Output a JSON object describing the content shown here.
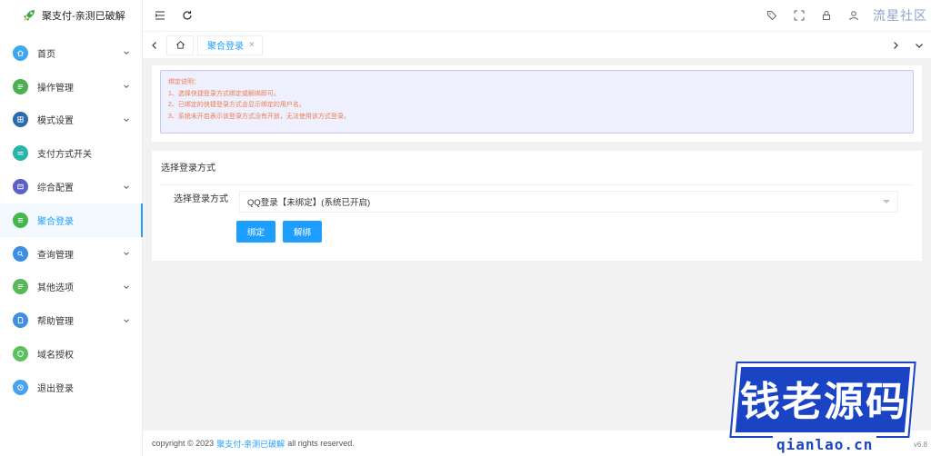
{
  "brand": {
    "title": "聚支付-亲测已破解"
  },
  "header": {
    "watermark": "流星社区"
  },
  "sidebar": {
    "items": [
      {
        "label": "首页",
        "icon": "home-icon",
        "color": "#3fa6f0",
        "has_children": true,
        "active": false
      },
      {
        "label": "操作管理",
        "icon": "list-icon",
        "color": "#4caf50",
        "has_children": true,
        "active": false
      },
      {
        "label": "模式设置",
        "icon": "grid-icon",
        "color": "#2b6cb0",
        "has_children": true,
        "active": false
      },
      {
        "label": "支付方式开关",
        "icon": "wave-icon",
        "color": "#26b5a8",
        "has_children": false,
        "active": false
      },
      {
        "label": "综合配置",
        "icon": "gear-icon",
        "color": "#5b5fc7",
        "has_children": true,
        "active": false
      },
      {
        "label": "聚合登录",
        "icon": "login-icon",
        "color": "#43b749",
        "has_children": false,
        "active": true
      },
      {
        "label": "查询管理",
        "icon": "search-icon",
        "color": "#3d8ee8",
        "has_children": true,
        "active": false
      },
      {
        "label": "其他选项",
        "icon": "list-icon",
        "color": "#57b85a",
        "has_children": true,
        "active": false
      },
      {
        "label": "帮助管理",
        "icon": "doc-icon",
        "color": "#3f8fe0",
        "has_children": true,
        "active": false
      },
      {
        "label": "域名授权",
        "icon": "shield-icon",
        "color": "#5cc05f",
        "has_children": false,
        "active": false
      },
      {
        "label": "退出登录",
        "icon": "clock-icon",
        "color": "#4aa3ef",
        "has_children": false,
        "active": false
      }
    ]
  },
  "tabs": {
    "items": [
      {
        "label": "聚合登录",
        "close": "×"
      }
    ]
  },
  "notice": {
    "lines": [
      "绑定说明：",
      "1、选择快捷登录方式绑定或解绑即可。",
      "2、已绑定的快捷登录方式会显示绑定的用户名。",
      "3、系统未开启表示该登录方式没有开放，无法使用该方式登录。"
    ]
  },
  "form": {
    "section_title": "选择登录方式",
    "label": "选择登录方式",
    "select_value": "QQ登录【未绑定】(系统已开启)",
    "bind_button": "绑定",
    "unbind_button": "解绑"
  },
  "footer": {
    "prefix": "copyright © 2023",
    "link": "聚支付-亲测已破解",
    "suffix": "all rights reserved.",
    "version": "v6.8"
  },
  "watermark": {
    "text": "钱老源码",
    "sub": "qianlao.cn"
  }
}
